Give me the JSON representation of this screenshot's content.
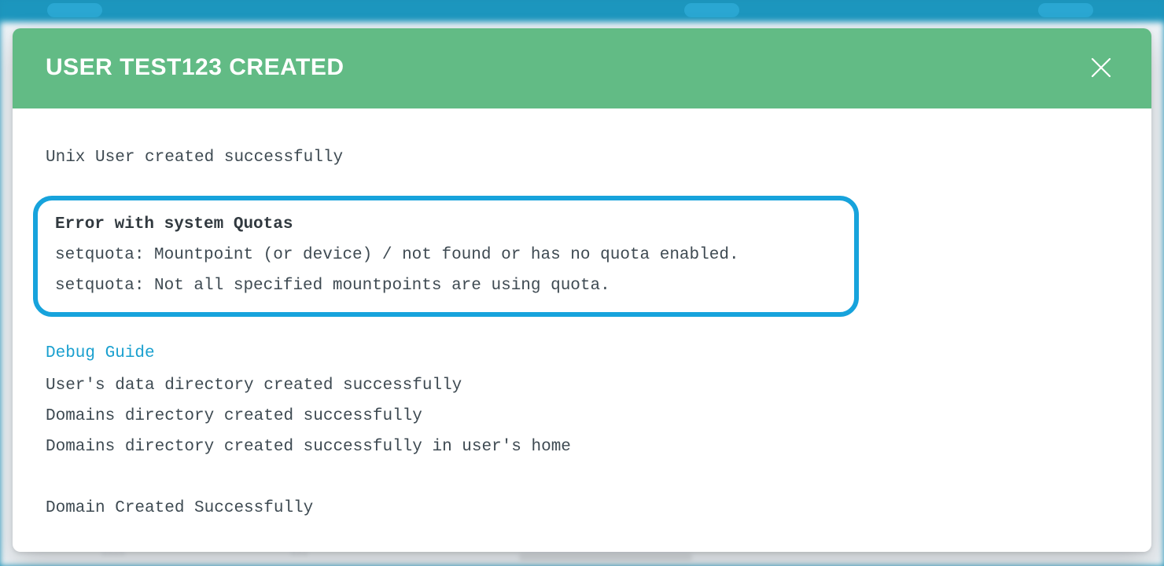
{
  "modal": {
    "title": "USER TEST123 CREATED",
    "intro_message": "Unix User created successfully",
    "error": {
      "heading": "Error with system Quotas",
      "line1": "setquota: Mountpoint (or device) / not found or has no quota enabled.",
      "line2": "setquota: Not all specified mountpoints are using quota."
    },
    "debug_link": "Debug Guide",
    "steps": {
      "data_dir": "User's data directory created successfully",
      "domains_dir": "Domains directory created successfully",
      "domains_home": "Domains directory created successfully in user's home",
      "domain_created": "Domain Created Successfully"
    }
  },
  "colors": {
    "header_bg": "#62bb85",
    "accent_border": "#17a3dc",
    "link": "#1aa0cf",
    "page_bg_top": "#1b93ba"
  }
}
